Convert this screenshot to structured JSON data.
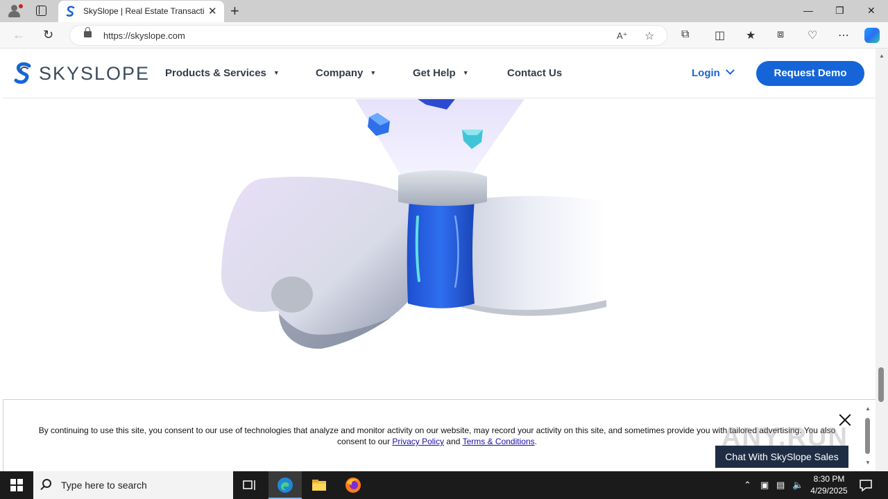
{
  "browser": {
    "tab_title": "SkySlope | Real Estate Transaction",
    "url": "https://skyslope.com",
    "minimize": "—",
    "restore": "❐",
    "close": "✕",
    "new_tab": "+"
  },
  "site": {
    "logo_text": "SKYSLOPE",
    "nav": [
      {
        "label": "Products & Services",
        "has_caret": true
      },
      {
        "label": "Company",
        "has_caret": true
      },
      {
        "label": "Get Help",
        "has_caret": true
      },
      {
        "label": "Contact Us",
        "has_caret": false
      }
    ],
    "login_label": "Login",
    "demo_label": "Request Demo",
    "brand_color": "#1565d8"
  },
  "cookie_banner": {
    "text_1": "By continuing to use this site, you consent to our use of technologies that analyze and monitor activity on our website, may record your activity on this site, and sometimes provide you with tailored advertising. You also consent to our ",
    "privacy_link": "Privacy Policy",
    "and": " and ",
    "terms_link": "Terms & Conditions",
    "end": "."
  },
  "chat": {
    "label": "Chat With SkySlope Sales"
  },
  "watermark": "ANY.RUN",
  "taskbar": {
    "search_placeholder": "Type here to search",
    "time": "8:30 PM",
    "date": "4/29/2025"
  }
}
